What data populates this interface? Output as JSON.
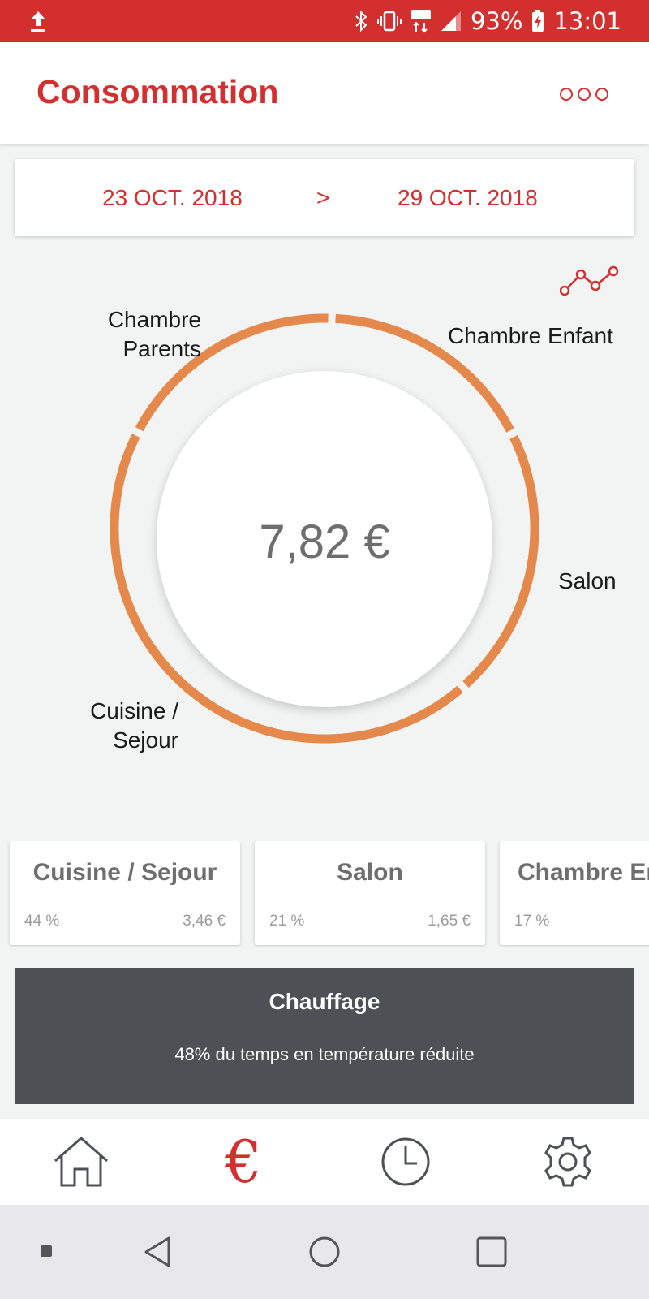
{
  "status_bar": {
    "battery": "93%",
    "time": "13:01",
    "network": "4G+",
    "icons": [
      "upload-icon",
      "bluetooth-icon",
      "vibrate-icon",
      "network-4g-icon",
      "signal-icon",
      "battery-charging-icon"
    ]
  },
  "header": {
    "title": "Consommation",
    "more_icon": "more-options-icon"
  },
  "date_range": {
    "start": "23 OCT. 2018",
    "separator": ">",
    "end": "29 OCT. 2018"
  },
  "chart_toggle_icon": "trend-line-icon",
  "donut": {
    "total": "7,82 €",
    "ring_color": "#e4894b",
    "labels": {
      "chambre_parents_1": "Chambre",
      "chambre_parents_2": "Parents",
      "chambre_enfant": "Chambre Enfant",
      "salon": "Salon",
      "cuisine_1": "Cuisine /",
      "cuisine_2": "Sejour"
    },
    "segments": [
      {
        "name": "Cuisine / Sejour",
        "share": 0.44
      },
      {
        "name": "Chambre Parents",
        "share": 0.18
      },
      {
        "name": "Chambre Enfant",
        "share": 0.17
      },
      {
        "name": "Salon",
        "share": 0.21
      }
    ]
  },
  "rooms": [
    {
      "name": "Cuisine / Sejour",
      "percent": "44 %",
      "cost": "3,46 €"
    },
    {
      "name": "Salon",
      "percent": "21 %",
      "cost": "1,65 €"
    },
    {
      "name": "Chambre Enfant",
      "percent": "17 %",
      "cost": ""
    }
  ],
  "heating": {
    "title": "Chauffage",
    "description": "48% du temps en température réduite"
  },
  "bottom_nav": {
    "items": [
      "home-icon",
      "euro-icon",
      "clock-icon",
      "settings-icon"
    ],
    "active": "euro-icon",
    "euro_glyph": "€"
  },
  "system_nav": [
    "recent-square-small-icon",
    "back-icon",
    "home-circle-icon",
    "overview-icon"
  ],
  "colors": {
    "accent": "#d32f2f",
    "ring": "#e4894b",
    "heating_card": "#4d5054"
  }
}
